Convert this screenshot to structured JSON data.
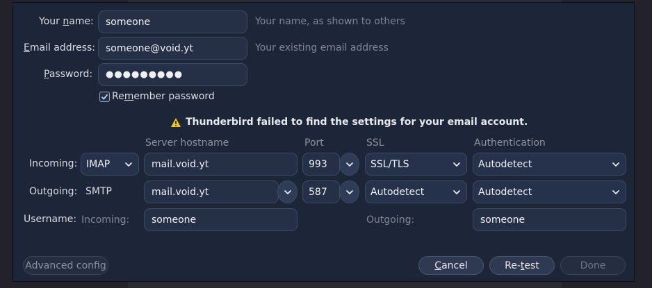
{
  "identity": {
    "name_label_pre": "Your ",
    "name_label_key": "n",
    "name_label_post": "ame:",
    "name_value": "someone",
    "name_hint": "Your name, as shown to others",
    "email_label_key": "E",
    "email_label_post": "mail address:",
    "email_value": "someone@void.yt",
    "email_hint": "Your existing email address",
    "password_label_key": "P",
    "password_label_post": "assword:",
    "password_value": "●●●●●●●●●",
    "remember_pre": "Re",
    "remember_key": "m",
    "remember_post": "ember password",
    "remember_checked": true
  },
  "warning": {
    "icon": "warning-triangle-icon",
    "text": "Thunderbird failed to find the settings for your email account."
  },
  "columns": {
    "hostname": "Server hostname",
    "port": "Port",
    "ssl": "SSL",
    "auth": "Authentication"
  },
  "incoming": {
    "label": "Incoming:",
    "protocol": "IMAP",
    "hostname": "mail.void.yt",
    "port": "993",
    "ssl": "SSL/TLS",
    "auth": "Autodetect"
  },
  "outgoing": {
    "label": "Outgoing:",
    "protocol": "SMTP",
    "hostname": "mail.void.yt",
    "port": "587",
    "ssl": "Autodetect",
    "auth": "Autodetect"
  },
  "username": {
    "label": "Username:",
    "incoming_label": "Incoming:",
    "incoming_value": "someone",
    "outgoing_label": "Outgoing:",
    "outgoing_value": "someone"
  },
  "buttons": {
    "advanced": "Advanced config",
    "cancel_key": "C",
    "cancel_post": "ancel",
    "retest_pre": "Re-",
    "retest_key": "t",
    "retest_post": "est",
    "done": "Done"
  },
  "colors": {
    "dialog_bg": "#1d2638",
    "field_bg": "#253047",
    "accent": "#8aa7d6",
    "warning": "#f5c518"
  }
}
